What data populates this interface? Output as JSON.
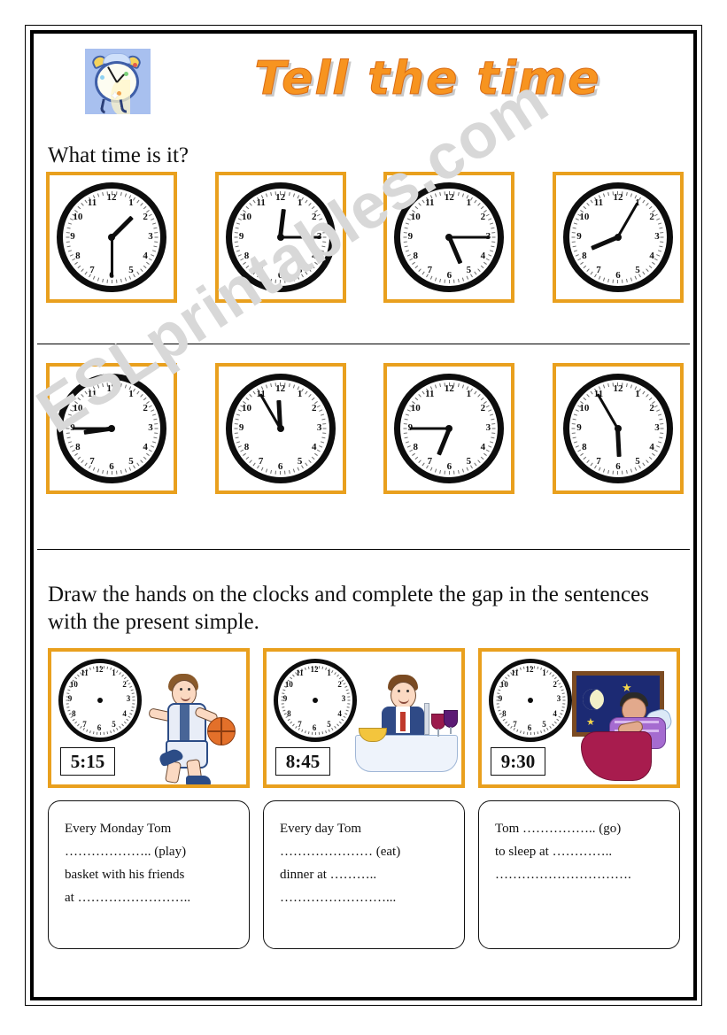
{
  "header": {
    "title": "Tell the time",
    "clipart_icon": "alarm-clock-clipart"
  },
  "watermark": "ESLprintables.com",
  "section_1": {
    "instruction": "What time is it?",
    "clocks": [
      {
        "id": "clock-1",
        "time": "1:30",
        "hour_angle": 45,
        "minute_angle": 180
      },
      {
        "id": "clock-2",
        "time": "12:15",
        "hour_angle": 7,
        "minute_angle": 90
      },
      {
        "id": "clock-3",
        "time": "5:15",
        "hour_angle": 157,
        "minute_angle": 90
      },
      {
        "id": "clock-4",
        "time": "8:05",
        "hour_angle": 247,
        "minute_angle": 30
      },
      {
        "id": "clock-5",
        "time": "8:45",
        "hour_angle": 262,
        "minute_angle": 270
      },
      {
        "id": "clock-6",
        "time": "11:55",
        "hour_angle": 357,
        "minute_angle": 330
      },
      {
        "id": "clock-7",
        "time": "6:45",
        "hour_angle": 202,
        "minute_angle": 270
      },
      {
        "id": "clock-8",
        "time": "5:55",
        "hour_angle": 177,
        "minute_angle": 330
      }
    ],
    "numerals": [
      "12",
      "1",
      "2",
      "3",
      "4",
      "5",
      "6",
      "7",
      "8",
      "9",
      "10",
      "11"
    ]
  },
  "section_2": {
    "instruction": "Draw the hands on the clocks and complete the gap in the sentences with the present simple.",
    "tasks": [
      {
        "id": "task-1",
        "time": "5:15",
        "picture": "basketball-player-clipart"
      },
      {
        "id": "task-2",
        "time": "8:45",
        "picture": "man-eating-dinner-clipart"
      },
      {
        "id": "task-3",
        "time": "9:30",
        "picture": "person-sleeping-clipart"
      }
    ],
    "sentences": [
      {
        "id": "sentence-1",
        "lines": [
          "Every Monday Tom",
          "……………….. (play)",
          "basket with his friends",
          "at …………………….."
        ]
      },
      {
        "id": "sentence-2",
        "lines": [
          "Every day Tom",
          "………………… (eat)",
          "dinner at ………..",
          "……………………..."
        ]
      },
      {
        "id": "sentence-3",
        "lines": [
          "Tom …………….. (go)",
          "to sleep at …………..",
          "………………………….",
          ""
        ]
      }
    ]
  },
  "colors": {
    "title_orange": "#f79420",
    "frame_orange": "#e9a01e",
    "clock_black": "#0d0d0d",
    "watermark_gray": "#d8d8d8",
    "clipart_background_blue": "#a8c0ef"
  }
}
